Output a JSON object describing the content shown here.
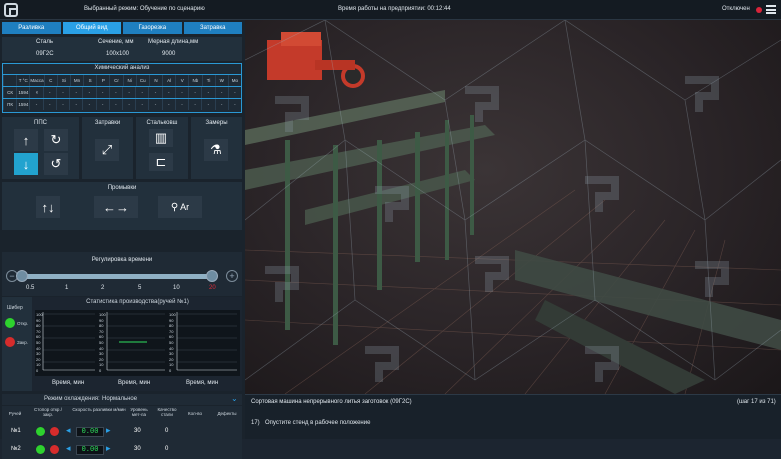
{
  "topbar": {
    "mode": "Выбранный режим: Обучение по сценарию",
    "work_time": "Время работы на предприятии: 00:12:44",
    "status": "Отключен",
    "status_color": "#d8243a"
  },
  "tabs": [
    {
      "label": "Разливка"
    },
    {
      "label": "Общий вид"
    },
    {
      "label": "Газорезка"
    },
    {
      "label": "Затравка"
    }
  ],
  "steel_info": {
    "steel_label": "Сталь",
    "steel_value": "09Г2С",
    "section_label": "Сечение, мм",
    "section_value": "100x100",
    "length_label": "Мерная длина,мм",
    "length_value": "9000"
  },
  "chem": {
    "title": "Химический анализ",
    "headers": [
      "",
      "T °C",
      "Масса т",
      "C",
      "Si",
      "Mn",
      "S",
      "P",
      "Cr",
      "Ni",
      "Cu",
      "N",
      "Al",
      "V",
      "Nb",
      "Ti",
      "W",
      "Mo"
    ],
    "rows": [
      [
        "СК",
        "1594",
        "-",
        "-",
        "-",
        "-",
        "-",
        "-",
        "-",
        "-",
        "-",
        "-",
        "-",
        "-",
        "-",
        "-",
        "-",
        "-"
      ],
      [
        "ПК",
        "1594",
        "-",
        "-",
        "-",
        "-",
        "-",
        "-",
        "-",
        "-",
        "-",
        "-",
        "-",
        "-",
        "-",
        "-",
        "-",
        "-"
      ]
    ]
  },
  "panels": {
    "pps": "ППС",
    "zatravki": "Затравки",
    "stalkovshi": "Стальковш",
    "zamery": "Замеры",
    "promyvki": "Промывки",
    "promyvki_ar": "Ar"
  },
  "time_reg": {
    "title": "Регулировка времени",
    "ticks": [
      "0.5",
      "1",
      "2",
      "5",
      "10",
      "20"
    ],
    "minus": "−",
    "plus": "+"
  },
  "stats": {
    "title": "Статистика производства(ручей №1)",
    "gate_label": "Шибер",
    "open_label": "Откр.",
    "close_label": "Закр.",
    "y_ticks": [
      "100",
      "90",
      "80",
      "70",
      "60",
      "50",
      "40",
      "30",
      "20",
      "10",
      "0"
    ],
    "x_label": "Время, мин"
  },
  "cooling": {
    "label": "Режим охлаждения:",
    "value": "Нормальное"
  },
  "streams": {
    "headers": [
      "Ручей",
      "Стопор откр./закр.",
      "Скорость разливки м/мин",
      "Уровень мет-ла",
      "Качество стали",
      "Кол-во",
      "Дефекты"
    ],
    "rows": [
      {
        "name": "№1",
        "speed": "0.00",
        "level": "30",
        "quality": "0"
      },
      {
        "name": "№2",
        "speed": "0.00",
        "level": "30",
        "quality": "0"
      }
    ]
  },
  "scene": {
    "title": "Сортовая машина непрерывного литья заготовок (09Г2С)",
    "step": "(шаг 17 из 71)",
    "instruction_num": "17)",
    "instruction": "Опустите стенд в рабочее положение"
  },
  "colors": {
    "accent": "#2aa0e6",
    "panel": "#22303c",
    "speed_digits": "#2fe05f"
  }
}
